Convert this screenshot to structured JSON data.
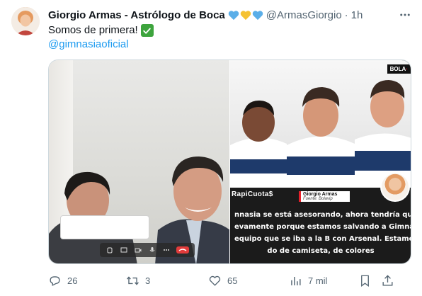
{
  "author": {
    "display_name": "Giorgio Armas - Astrólogo de Boca",
    "handle": "@ArmasGiorgio",
    "separator": "·",
    "time": "1h",
    "name_emojis": [
      "blue-heart",
      "yellow-heart",
      "blue-heart"
    ]
  },
  "tweet": {
    "text": "Somos de primera!",
    "mention": "@gimnasiaoficial"
  },
  "media": {
    "right_image": {
      "brand": "BOLA",
      "sponsors": [
        "RapiCuota$",
        "RapiCuota$"
      ],
      "source_name": "Giorgio Armas",
      "source_label": "Fuente: Bolavip",
      "quote_lines": [
        "nnasia se está asesorando, ahora tendría que analiza",
        "evamente porque estamos salvando a Gimnasia que e",
        "equipo que se iba a la B con Arsenal. Estamos cambia",
        "do de camiseta, de colores"
      ]
    }
  },
  "actions": {
    "replies": "26",
    "retweets": "3",
    "likes": "65",
    "views": "7 mil"
  },
  "colors": {
    "accent": "#1d9bf0",
    "secondary_text": "#536471",
    "check_green": "#3da43d"
  }
}
